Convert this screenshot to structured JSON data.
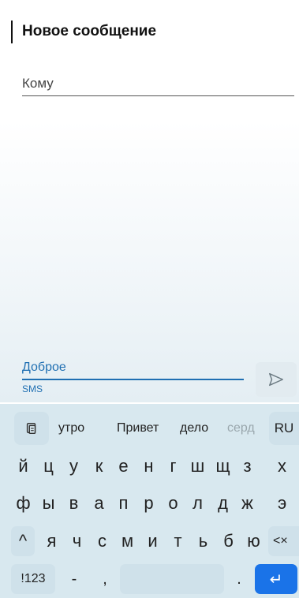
{
  "header": {
    "title": "Новое сообщение"
  },
  "recipient": {
    "label": "Кому"
  },
  "compose": {
    "text": "Доброе",
    "channel": "SMS"
  },
  "keyboard": {
    "suggestions": [
      "утро",
      "Привет",
      "дело",
      "серд"
    ],
    "language": "RU",
    "row1": [
      "й",
      "ц",
      "у",
      "к",
      "е",
      "н",
      "г",
      "ш",
      "щ",
      "з",
      "х"
    ],
    "row2": [
      "ф",
      "ы",
      "в",
      "а",
      "п",
      "р",
      "о",
      "л",
      "д",
      "ж",
      "э"
    ],
    "row3": [
      "я",
      "ч",
      "с",
      "м",
      "и",
      "т",
      "ь",
      "б",
      "ю"
    ],
    "shift_symbol": "^",
    "backspace_symbol": "<×",
    "numbers_label": "!123",
    "dash": "-",
    "comma": ",",
    "period": ".",
    "enter_symbol": "↵",
    "accent_color": "#1a73e8"
  }
}
